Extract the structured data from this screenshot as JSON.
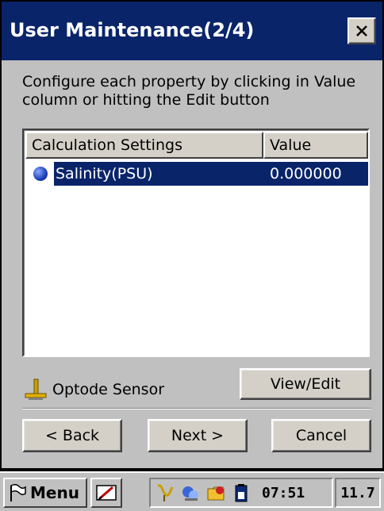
{
  "window": {
    "title": "User Maintenance(2/4)",
    "instructions": "Configure each property by clicking in Value column or hitting the Edit button"
  },
  "list": {
    "columns": [
      "Calculation Settings",
      "Value"
    ],
    "rows": [
      {
        "name": "Salinity(PSU)",
        "value": "0.000000",
        "icon": "blue-dot-icon",
        "selected": true
      }
    ]
  },
  "sensor": {
    "label": "Optode Sensor",
    "icon": "sensor-icon"
  },
  "buttons": {
    "view_edit": "View/Edit",
    "back": "< Back",
    "next": "Next >",
    "cancel": "Cancel"
  },
  "taskbar": {
    "menu_label": "Menu",
    "time": "07:51",
    "extra": "11.7"
  },
  "colors": {
    "titlebar": "#0a246a",
    "window_bg": "#c0c0c0",
    "selection": "#0a246a"
  }
}
